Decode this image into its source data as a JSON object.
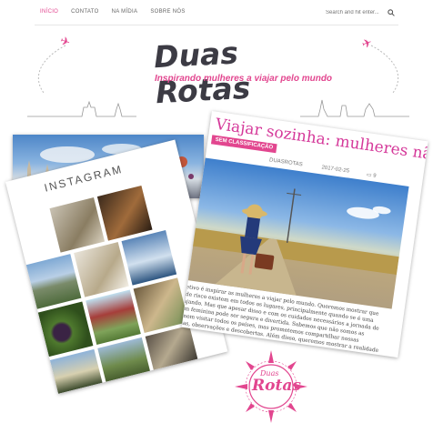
{
  "nav": {
    "items": [
      "Início",
      "Contato",
      "Na Mídia",
      "Sobre Nós"
    ],
    "active_index": 0,
    "search_placeholder": "Search and hit enter..."
  },
  "header": {
    "logo_text": "Duas Rotas",
    "tagline": "Inspirando mulheres a viajar pelo mundo"
  },
  "post": {
    "title": "Viajar sozinha: mulheres não tenham medo",
    "category": "SEM CLASSIFICAÇÃO",
    "author": "DUASROTAS",
    "date": "2017-02-25",
    "comments": "9",
    "excerpt": "Nosso objetivo é inspirar as mulheres a viajar pelo mundo. Queremos mostrar que situações de risco existem em todos os lugares, principalmente quando se é uma mulher viajando. Mas que apesar disso e com os cuidados necessários a jornada de uma viagem feminina pode ser segura e divertida. Sabemos que não somos as primeiras nem visitar todos os países, mas prometemos compartilhar nossas experiências, observações e descobertas. Além disso, queremos mostrar a realidade de nossas viagens com honestidade e humor, na esperança de ajudar futuras viajantes."
  },
  "instagram": {
    "label": "INSTAGRAM"
  },
  "badge": {
    "text_top": "Duas",
    "text_bottom": "Rotas"
  },
  "colors": {
    "accent": "#e2468f",
    "logo_dark": "#3c3b44"
  }
}
